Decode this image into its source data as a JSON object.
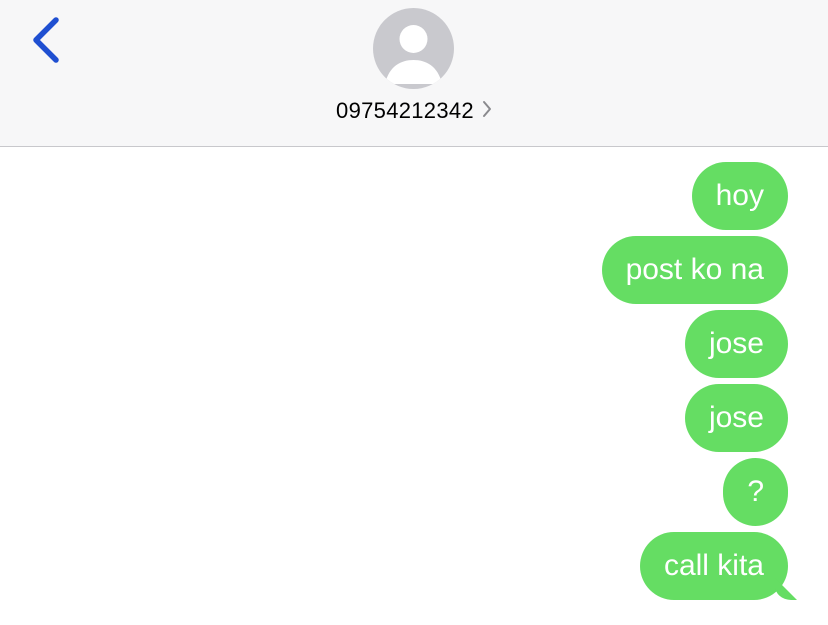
{
  "header": {
    "contact": "09754212342",
    "back_icon": "chevron-left-icon",
    "disclosure_icon": "chevron-right-icon",
    "avatar_icon": "person-silhouette-icon"
  },
  "messages": [
    {
      "text": "hoy",
      "direction": "outgoing"
    },
    {
      "text": "post ko na",
      "direction": "outgoing"
    },
    {
      "text": "jose",
      "direction": "outgoing"
    },
    {
      "text": "jose",
      "direction": "outgoing"
    },
    {
      "text": "?",
      "direction": "outgoing"
    },
    {
      "text": "call kita",
      "direction": "outgoing"
    }
  ],
  "colors": {
    "accent": "#1f4fd1",
    "bubble": "#65dd63",
    "header_bg": "#f7f7f8",
    "avatar_bg": "#c9c9ce"
  }
}
